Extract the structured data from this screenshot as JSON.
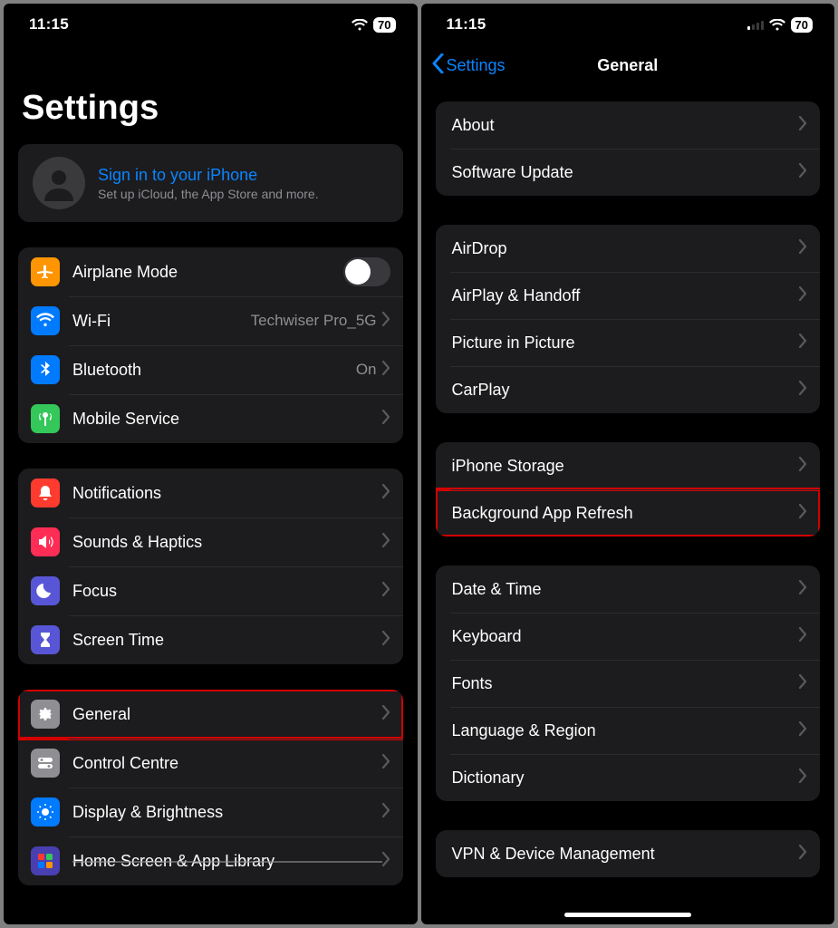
{
  "status": {
    "time": "11:15",
    "battery": "70"
  },
  "left": {
    "title": "Settings",
    "signin": {
      "title": "Sign in to your iPhone",
      "sub": "Set up iCloud, the App Store and more."
    },
    "g1": [
      {
        "label": "Airplane Mode",
        "icon": "airplane",
        "bg": "#ff9500",
        "control": "toggle"
      },
      {
        "label": "Wi-Fi",
        "icon": "wifi",
        "bg": "#007aff",
        "value": "Techwiser Pro_5G"
      },
      {
        "label": "Bluetooth",
        "icon": "bluetooth",
        "bg": "#007aff",
        "value": "On"
      },
      {
        "label": "Mobile Service",
        "icon": "antenna",
        "bg": "#34c759"
      }
    ],
    "g2": [
      {
        "label": "Notifications",
        "icon": "bell",
        "bg": "#ff3b30"
      },
      {
        "label": "Sounds & Haptics",
        "icon": "speaker",
        "bg": "#ff2d55"
      },
      {
        "label": "Focus",
        "icon": "moon",
        "bg": "#5856d6"
      },
      {
        "label": "Screen Time",
        "icon": "hourglass",
        "bg": "#5856d6"
      }
    ],
    "g3": [
      {
        "label": "General",
        "icon": "gear",
        "bg": "#8e8e93",
        "highlight": true
      },
      {
        "label": "Control Centre",
        "icon": "switches",
        "bg": "#8e8e93"
      },
      {
        "label": "Display & Brightness",
        "icon": "sun",
        "bg": "#007aff"
      },
      {
        "label": "Home Screen & App Library",
        "icon": "grid",
        "bg": "#4840b0",
        "cut": true
      }
    ]
  },
  "right": {
    "back": "Settings",
    "title": "General",
    "g1": [
      {
        "label": "About"
      },
      {
        "label": "Software Update"
      }
    ],
    "g2": [
      {
        "label": "AirDrop"
      },
      {
        "label": "AirPlay & Handoff"
      },
      {
        "label": "Picture in Picture"
      },
      {
        "label": "CarPlay"
      }
    ],
    "g3": [
      {
        "label": "iPhone Storage"
      },
      {
        "label": "Background App Refresh",
        "highlight": true
      }
    ],
    "g4": [
      {
        "label": "Date & Time"
      },
      {
        "label": "Keyboard"
      },
      {
        "label": "Fonts"
      },
      {
        "label": "Language & Region"
      },
      {
        "label": "Dictionary"
      }
    ],
    "g5": [
      {
        "label": "VPN & Device Management"
      }
    ]
  }
}
